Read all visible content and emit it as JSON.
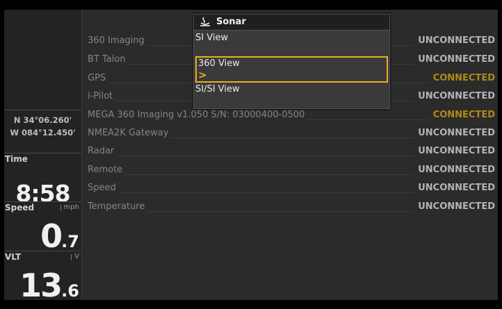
{
  "side_panel": {
    "coords": {
      "lat": "N 34°06.260'",
      "lon": "W 084°12.450'"
    },
    "time": {
      "label": "Time",
      "value": "8:58"
    },
    "speed": {
      "label": "Speed",
      "unit": "mph",
      "int": "0",
      "dec": ".7"
    },
    "vlt": {
      "label": "VLT",
      "unit": "V",
      "int": "13",
      "dec": ".6"
    }
  },
  "devices": [
    {
      "name": "360 Imaging",
      "status": "UNCONNECTED"
    },
    {
      "name": "BT Talon",
      "status": "UNCONNECTED"
    },
    {
      "name": "GPS",
      "status": "CONNECTED"
    },
    {
      "name": "i-Pilot",
      "status": "UNCONNECTED"
    },
    {
      "name": "MEGA 360 Imaging v1.050 S/N: 03000400-0500",
      "status": "CONNECTED"
    },
    {
      "name": "NMEA2K Gateway",
      "status": "UNCONNECTED"
    },
    {
      "name": "Radar",
      "status": "UNCONNECTED"
    },
    {
      "name": "Remote",
      "status": "UNCONNECTED"
    },
    {
      "name": "Speed",
      "status": "UNCONNECTED"
    },
    {
      "name": "Temperature",
      "status": "UNCONNECTED"
    }
  ],
  "popup": {
    "title": "Sonar",
    "icon": "sonar-icon",
    "items": [
      "SI View",
      "360 View",
      "SI/SI View"
    ],
    "selected": "360 View",
    "chevron_icon": ">"
  },
  "colors": {
    "connected": "#b08a16",
    "unconnected": "#b4b4b4",
    "selection": "#e8b024"
  }
}
